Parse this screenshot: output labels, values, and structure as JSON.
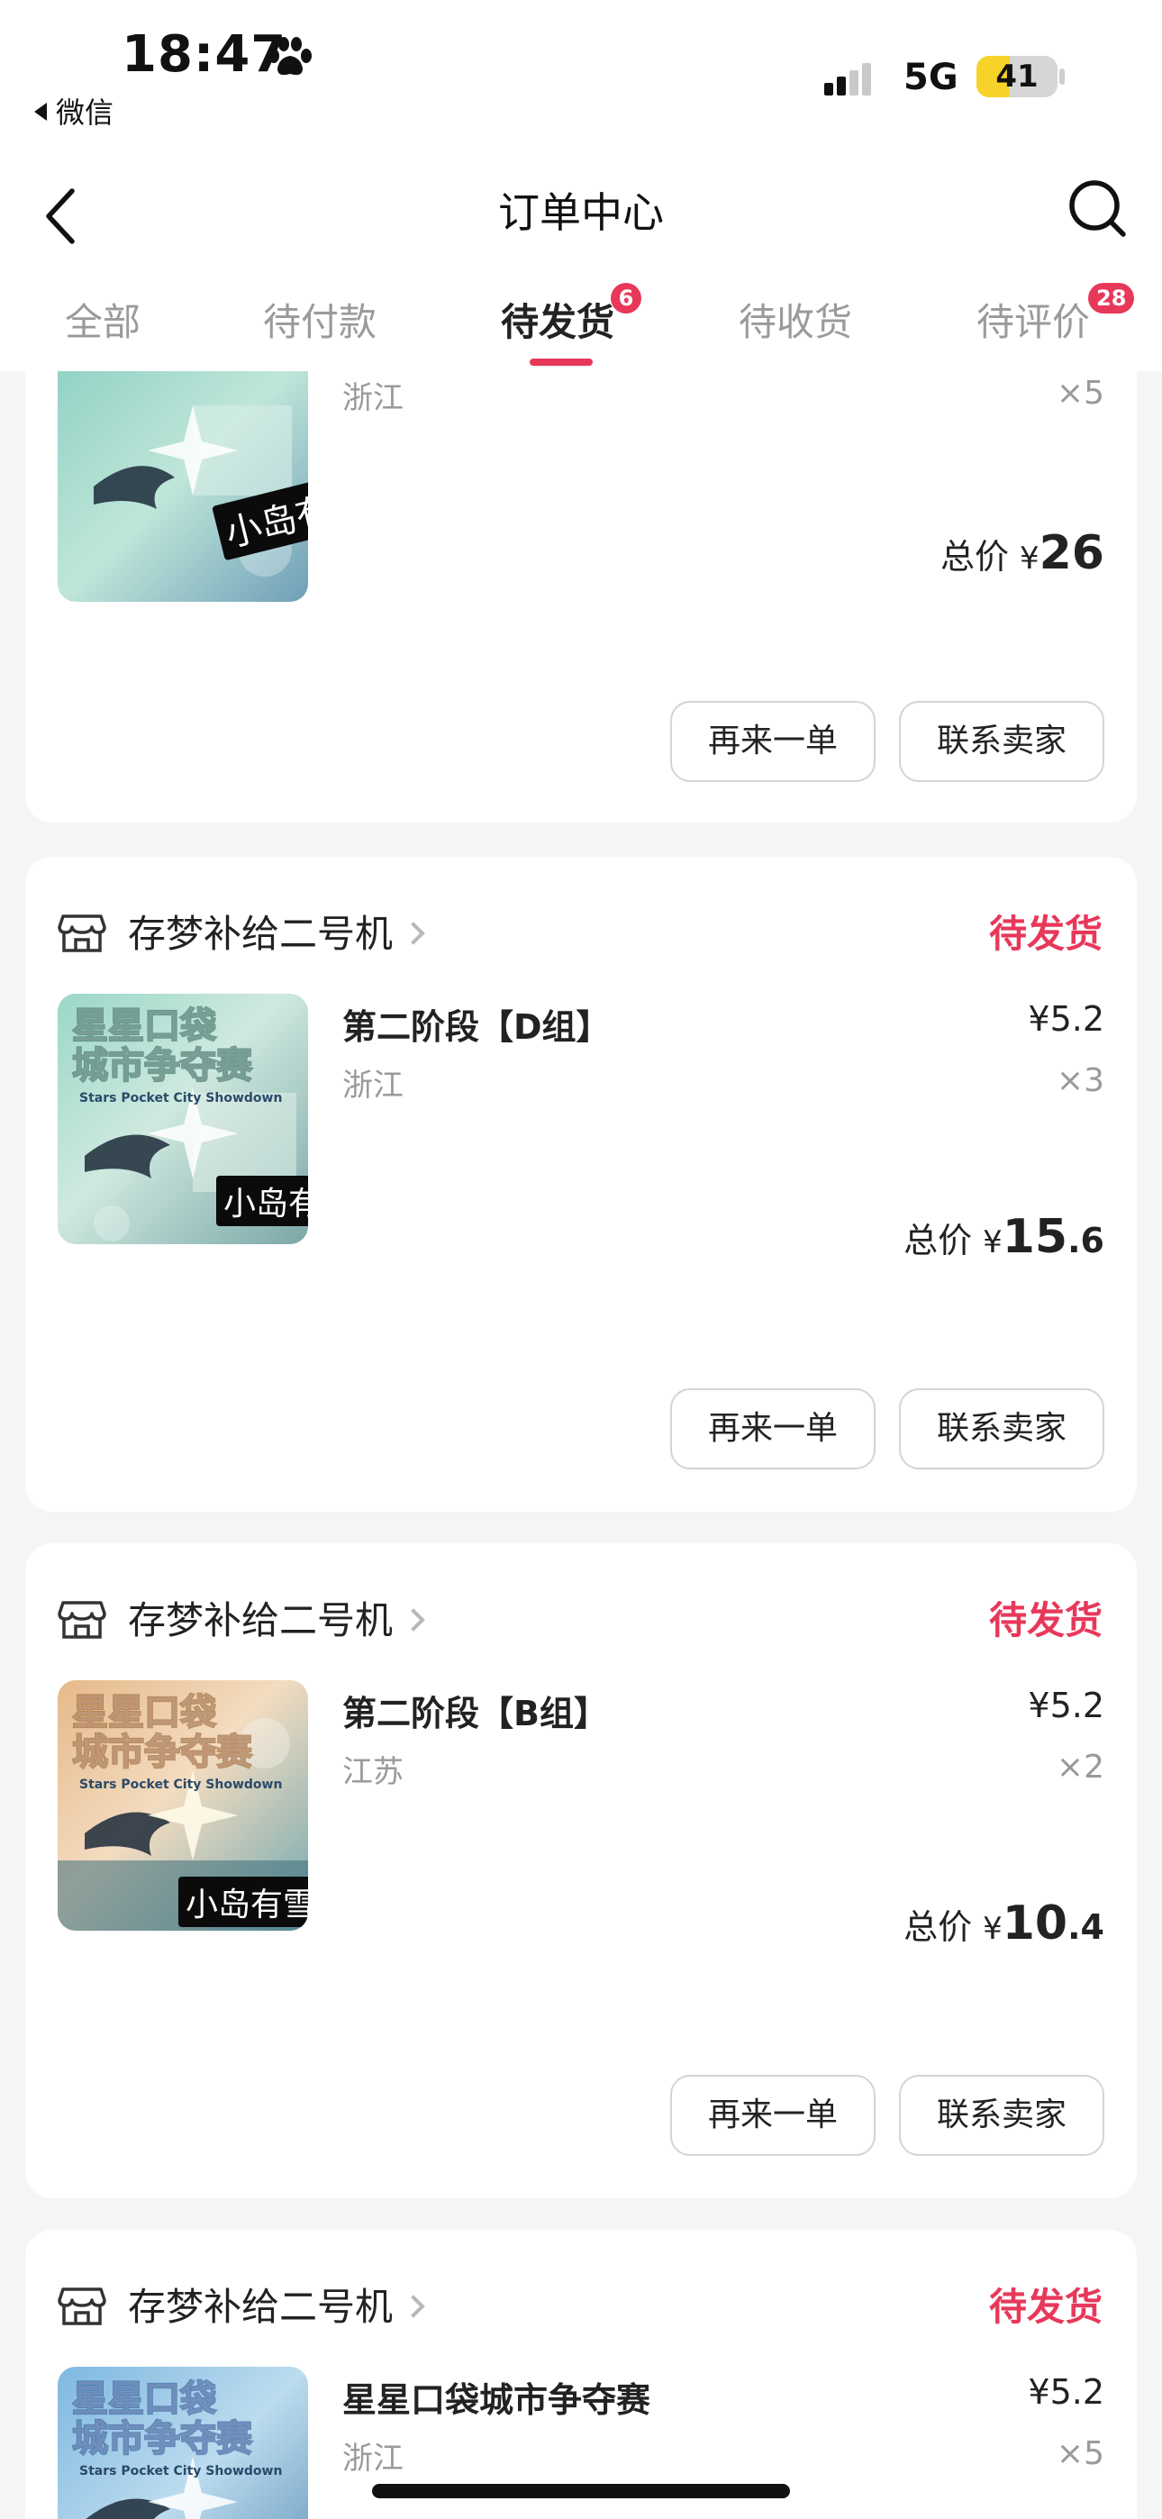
{
  "status_bar": {
    "time": "18:47",
    "back_app": "微信",
    "network": "5G",
    "battery_level": 41,
    "battery_text": "41"
  },
  "nav": {
    "title": "订单中心"
  },
  "tabs": [
    {
      "label": "全部",
      "active": false,
      "badge": ""
    },
    {
      "label": "待付款",
      "active": false,
      "badge": ""
    },
    {
      "label": "待发货",
      "active": true,
      "badge": "6"
    },
    {
      "label": "待收货",
      "active": false,
      "badge": ""
    },
    {
      "label": "待评价",
      "active": false,
      "badge": "28"
    }
  ],
  "orders": [
    {
      "shop": "",
      "status": "",
      "product": "",
      "price": "",
      "region": "浙江",
      "qty": "×5",
      "sticker": "小岛有雪",
      "total_label": "总价",
      "total_yen": "¥",
      "total_int": "26",
      "total_dec": "",
      "btn_reorder": "再来一单",
      "btn_contact": "联系卖家"
    },
    {
      "shop": "存梦补给二号机",
      "status": "待发货",
      "product": "第二阶段【D组】",
      "price": "¥5.2",
      "region": "浙江",
      "qty": "×3",
      "sticker": "小岛有雪",
      "total_label": "总价",
      "total_yen": "¥",
      "total_int": "15",
      "total_dec": ".6",
      "btn_reorder": "再来一单",
      "btn_contact": "联系卖家"
    },
    {
      "shop": "存梦补给二号机",
      "status": "待发货",
      "product": "第二阶段【B组】",
      "price": "¥5.2",
      "region": "江苏",
      "qty": "×2",
      "sticker": "小岛有雪",
      "total_label": "总价",
      "total_yen": "¥",
      "total_int": "10",
      "total_dec": ".4",
      "btn_reorder": "再来一单",
      "btn_contact": "联系卖家"
    },
    {
      "shop": "存梦补给二号机",
      "status": "待发货",
      "product": "星星口袋城市争夺赛",
      "price": "¥5.2",
      "region": "浙江",
      "qty": "×5",
      "sticker": "",
      "total_label": "",
      "total_yen": "",
      "total_int": "",
      "total_dec": "",
      "btn_reorder": "",
      "btn_contact": ""
    }
  ],
  "thumbnail_art": {
    "title_line1": "星星口袋",
    "title_line2": "城市争夺赛",
    "subtitle": "Stars Pocket City Showdown"
  },
  "colors": {
    "accent": "#e8385a",
    "muted_text": "#9a9a9a",
    "background": "#f5f5f5",
    "battery": "#f7d32a"
  },
  "icons": [
    "paw-icon",
    "signal-icon",
    "back-arrow-icon",
    "search-icon",
    "store-icon",
    "chevron-right-icon"
  ]
}
